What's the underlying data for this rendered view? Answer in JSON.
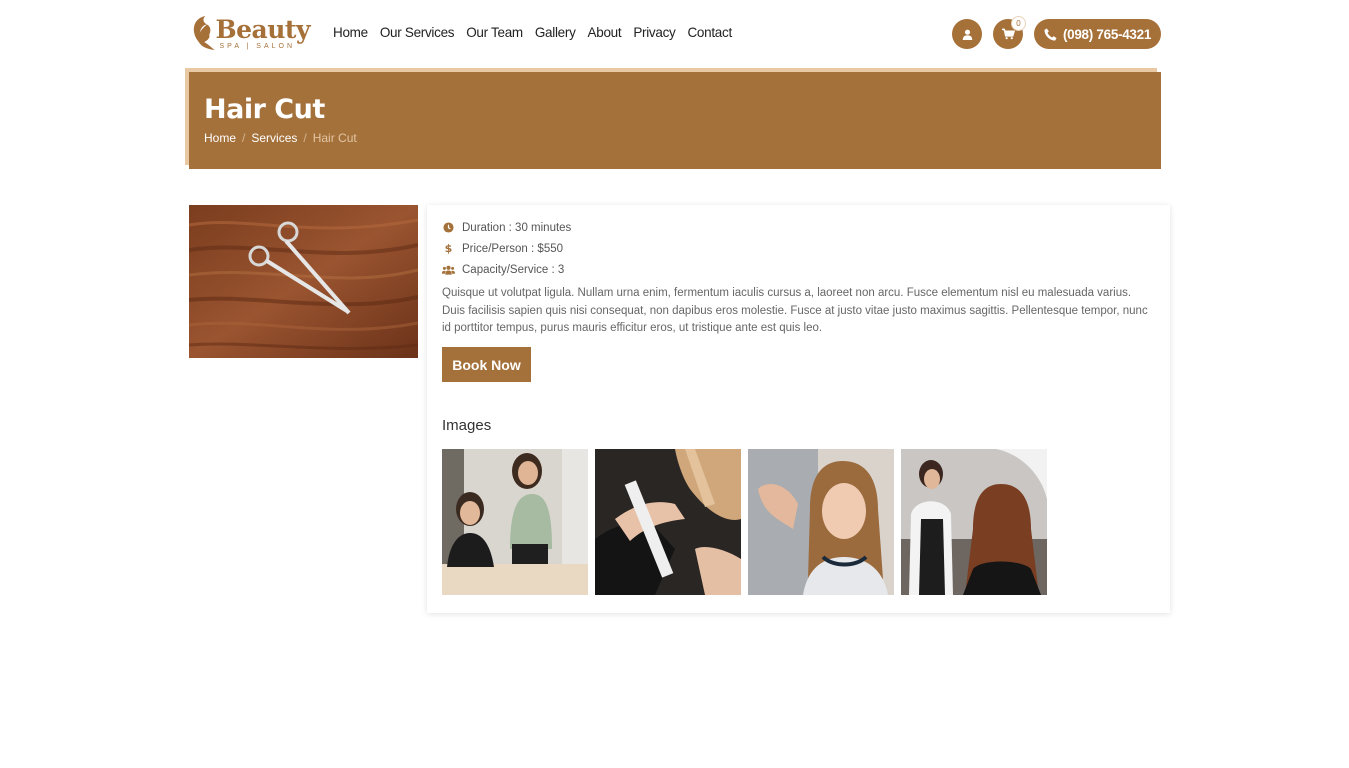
{
  "header": {
    "logo": {
      "word": "Beauty",
      "subtitle": "SPA | SALON"
    },
    "nav": [
      {
        "label": "Home"
      },
      {
        "label": "Our Services"
      },
      {
        "label": "Our Team"
      },
      {
        "label": "Gallery"
      },
      {
        "label": "About"
      },
      {
        "label": "Privacy"
      },
      {
        "label": "Contact"
      }
    ],
    "cart_count": "0",
    "phone": "(098) 765-4321",
    "icons": {
      "user": "user-icon",
      "cart": "cart-icon",
      "phone": "phone-icon"
    }
  },
  "banner": {
    "title": "Hair Cut",
    "breadcrumb": {
      "home": "Home",
      "sep": "/",
      "services": "Services",
      "current": "Hair Cut"
    }
  },
  "service": {
    "duration": "Duration : 30 minutes",
    "price": "Price/Person : $550",
    "capacity": "Capacity/Service : 3",
    "description": "Quisque ut volutpat ligula. Nullam urna enim, fermentum iaculis cursus a, laoreet non arcu. Fusce elementum nisl eu malesuada varius. Duis facilisis sapien quis nisi consequat, non dapibus eros molestie. Fusce at justo vitae justo maximus sagittis. Pellentesque tempor, nunc id porttitor tempus, purus mauris efficitur eros, ut tristique ante est quis leo.",
    "book_label": "Book Now",
    "images_heading": "Images"
  },
  "colors": {
    "accent": "#a4713a",
    "accent_light": "#e8c9a4"
  }
}
